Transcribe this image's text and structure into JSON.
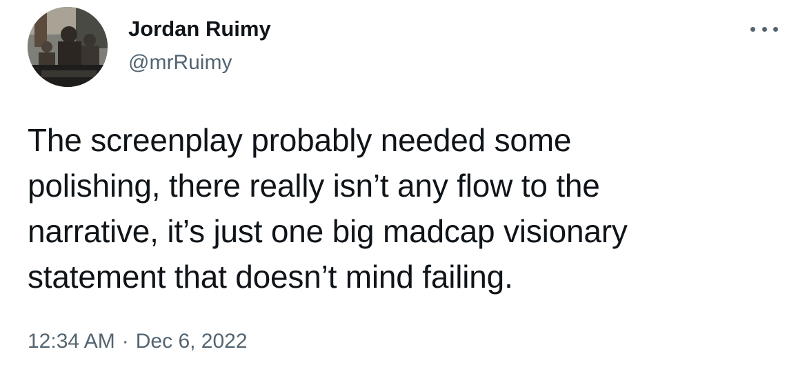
{
  "author": {
    "name": "Jordan Ruimy",
    "handle": "@mrRuimy"
  },
  "tweet": {
    "lines": [
      "The screenplay probably needed some",
      "polishing, there really isn’t any flow to the",
      "narrative, it’s just one big madcap visionary",
      "statement that doesn’t mind failing."
    ],
    "time": "12:34 AM",
    "separator": "·",
    "date": "Dec 6, 2022"
  },
  "icons": {
    "more": "more-horizontal-icon"
  },
  "colors": {
    "text": "#0f1419",
    "secondary": "#536471",
    "background": "#ffffff"
  }
}
